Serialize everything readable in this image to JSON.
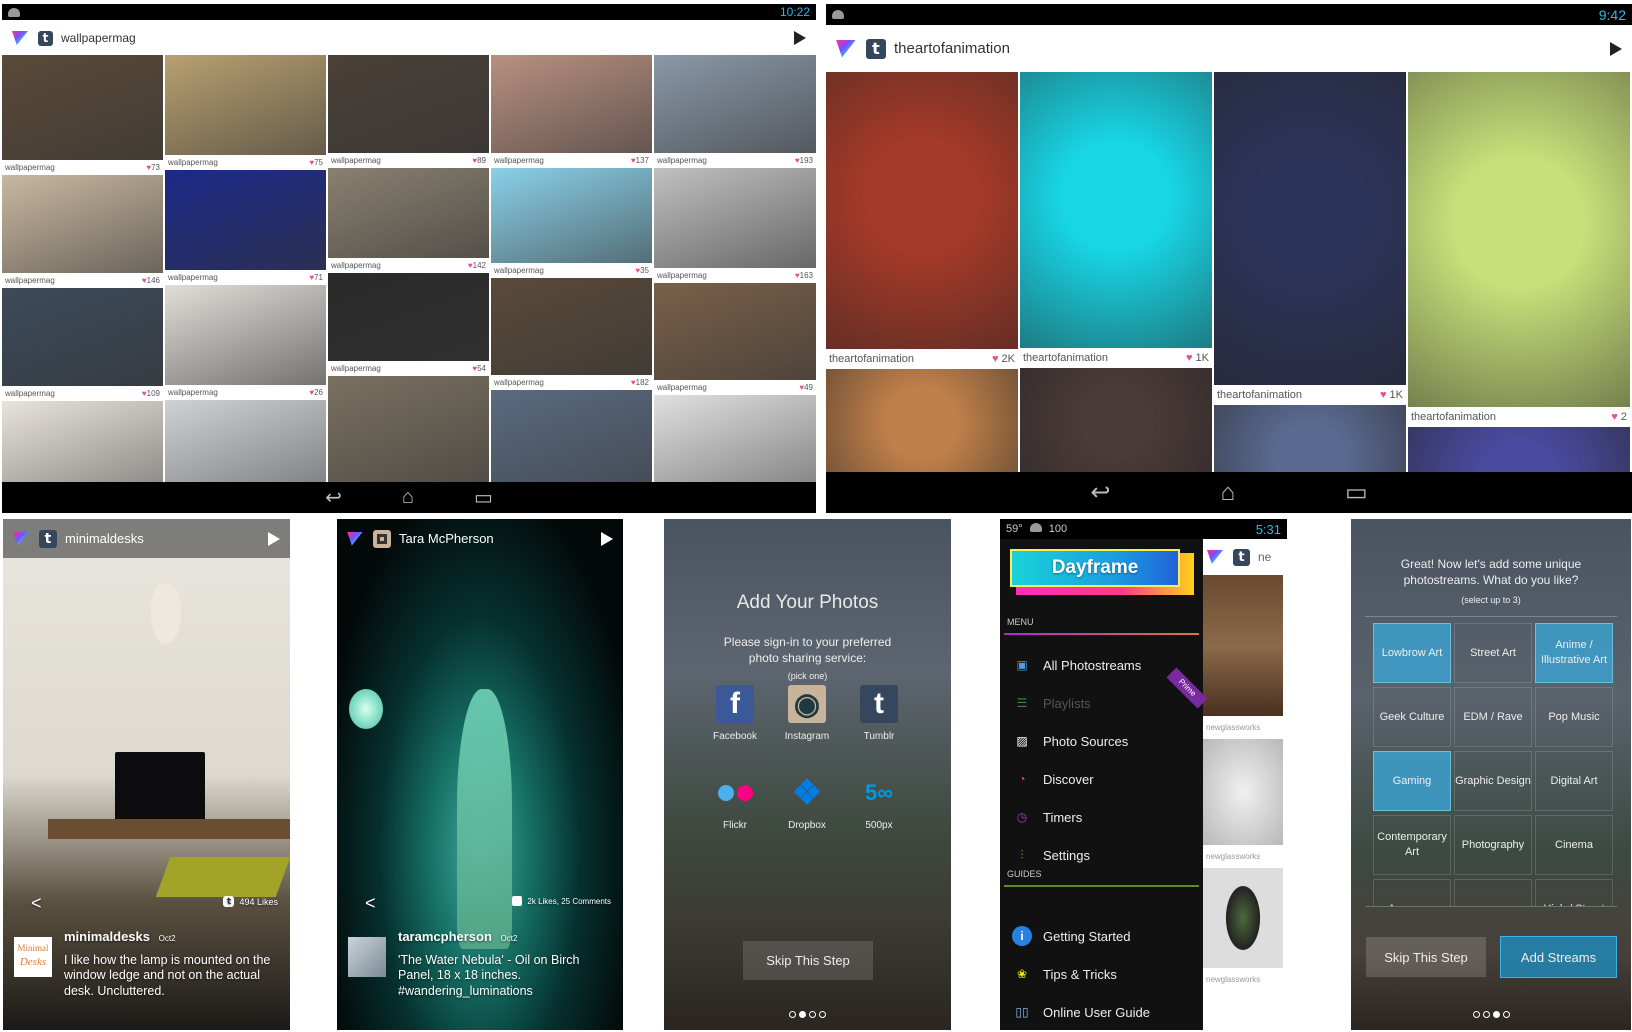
{
  "wallpapermag_tablet": {
    "status_time": "10:22",
    "stream_name": "wallpapermag",
    "columns": [
      [
        {
          "user": "wallpapermag",
          "likes": "73"
        },
        {
          "user": "wallpapermag",
          "likes": "146"
        },
        {
          "user": "wallpapermag",
          "likes": "109"
        },
        {
          "user": "",
          "likes": ""
        }
      ],
      [
        {
          "user": "wallpapermag",
          "likes": "75"
        },
        {
          "user": "wallpapermag",
          "likes": "71"
        },
        {
          "user": "wallpapermag",
          "likes": "26"
        },
        {
          "user": "",
          "likes": ""
        }
      ],
      [
        {
          "user": "wallpapermag",
          "likes": "89"
        },
        {
          "user": "wallpapermag",
          "likes": "142"
        },
        {
          "user": "wallpapermag",
          "likes": "54"
        },
        {
          "user": "",
          "likes": ""
        }
      ],
      [
        {
          "user": "wallpapermag",
          "likes": "137"
        },
        {
          "user": "wallpapermag",
          "likes": "35"
        },
        {
          "user": "wallpapermag",
          "likes": "182"
        },
        {
          "user": "",
          "likes": ""
        }
      ],
      [
        {
          "user": "wallpapermag",
          "likes": "193"
        },
        {
          "user": "wallpapermag",
          "likes": "163"
        },
        {
          "user": "wallpapermag",
          "likes": "49"
        },
        {
          "user": "",
          "likes": ""
        }
      ]
    ]
  },
  "theartofanimation_tablet": {
    "status_time": "9:42",
    "stream_name": "theartofanimation",
    "columns": [
      [
        {
          "user": "theartofanimation",
          "likes": "2K"
        },
        {
          "user": "",
          "likes": ""
        }
      ],
      [
        {
          "user": "theartofanimation",
          "likes": "1K"
        },
        {
          "user": "",
          "likes": ""
        }
      ],
      [
        {
          "user": "theartofanimation",
          "likes": "1K"
        },
        {
          "user": "",
          "likes": ""
        }
      ],
      [
        {
          "user": "theartofanimation",
          "likes": "2"
        },
        {
          "user": "",
          "likes": ""
        }
      ]
    ]
  },
  "minimaldesks_phone": {
    "stream_name": "minimaldesks",
    "likes": "494 Likes",
    "avatar_text": [
      "Minimal",
      "Desks"
    ],
    "author": "minimaldesks",
    "date": "Oct2",
    "caption": "I like how the lamp is mounted on the window ledge and not on the actual desk.  Uncluttered."
  },
  "tara_phone": {
    "stream_name": "Tara McPherson",
    "likes": "2k Likes, 25 Comments",
    "author": "taramcpherson",
    "date": "Oct2",
    "caption": "'The Water Nebula' - Oil on Birch Panel, 18 x 18 inches. #wandering_luminations"
  },
  "add_photos_phone": {
    "title": "Add Your Photos",
    "subtitle": "Please sign-in to your preferred photo sharing service:",
    "hint": "(pick one)",
    "services": [
      {
        "label": "Facebook",
        "icon": "facebook-icon",
        "color": "#3b5998"
      },
      {
        "label": "Instagram",
        "icon": "instagram-icon",
        "color": "#c8b39b"
      },
      {
        "label": "Tumblr",
        "icon": "tumblr-icon",
        "color": "#36465d"
      },
      {
        "label": "Flickr",
        "icon": "flickr-icon",
        "color": "#ff0084"
      },
      {
        "label": "Dropbox",
        "icon": "dropbox-icon",
        "color": "#007ee5"
      },
      {
        "label": "500px",
        "icon": "500px-icon",
        "color": "#0099e5"
      }
    ],
    "skip_label": "Skip This Step",
    "page_index": 2,
    "page_count": 4
  },
  "dayframe_phone": {
    "status_left": [
      "59°",
      "100"
    ],
    "status_time": "5:31",
    "brand": "Dayframe",
    "menu_header": "MENU",
    "menu_items": [
      {
        "label": "All Photostreams",
        "icon": "photostreams-icon"
      },
      {
        "label": "Playlists",
        "icon": "playlist-icon",
        "disabled": true,
        "badge": "Prime"
      },
      {
        "label": "Photo Sources",
        "icon": "photo-sources-icon"
      },
      {
        "label": "Discover",
        "icon": "compass-icon"
      },
      {
        "label": "Timers",
        "icon": "clock-icon"
      },
      {
        "label": "Settings",
        "icon": "sliders-icon"
      }
    ],
    "guides_header": "GUIDES",
    "guide_items": [
      {
        "label": "Getting Started",
        "icon": "info-icon"
      },
      {
        "label": "Tips & Tricks",
        "icon": "lightbulb-icon"
      },
      {
        "label": "Online User Guide",
        "icon": "book-icon"
      }
    ],
    "background_stream": "ne",
    "background_captions": [
      "newglassworks",
      "newglassworks",
      "newglassworks"
    ]
  },
  "streams_phone": {
    "prompt": "Great! Now let's add some unique photostreams. What do you like?",
    "hint": "(select up to 3)",
    "categories": [
      {
        "label": "Lowbrow Art",
        "selected": true
      },
      {
        "label": "Street Art",
        "selected": false
      },
      {
        "label": "Anime / Illustrative Art",
        "selected": true
      },
      {
        "label": "Geek Culture",
        "selected": false
      },
      {
        "label": "EDM / Rave",
        "selected": false
      },
      {
        "label": "Pop Music",
        "selected": false
      },
      {
        "label": "Gaming",
        "selected": true
      },
      {
        "label": "Graphic Design",
        "selected": false
      },
      {
        "label": "Digital Art",
        "selected": false
      },
      {
        "label": "Contemporary Art",
        "selected": false
      },
      {
        "label": "Photography",
        "selected": false
      },
      {
        "label": "Cinema",
        "selected": false
      },
      {
        "label": "Awesome",
        "selected": false
      },
      {
        "label": "",
        "selected": false
      },
      {
        "label": "High / Street",
        "selected": false
      }
    ],
    "skip_label": "Skip This Step",
    "add_label": "Add Streams",
    "page_index": 3,
    "page_count": 4
  }
}
